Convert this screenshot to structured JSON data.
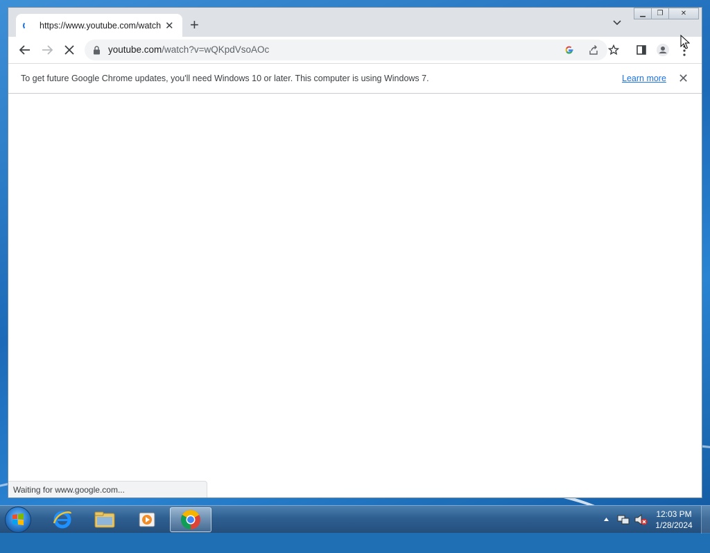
{
  "browser": {
    "tab_title": "https://www.youtube.com/watch",
    "url_host": "youtube.com",
    "url_path": "/watch?v=wQKpdVsoAOc",
    "status_text": "Waiting for www.google.com..."
  },
  "infobar": {
    "message": "To get future Google Chrome updates, you'll need Windows 10 or later. This computer is using Windows 7.",
    "learn_more": "Learn more"
  },
  "taskbar": {
    "time": "12:03 PM",
    "date": "1/28/2024",
    "items": [
      "internet-explorer",
      "windows-explorer",
      "media-player",
      "google-chrome"
    ]
  },
  "colors": {
    "accent": "#1a73e8",
    "toolbar_bg": "#ffffff",
    "tabstrip_bg": "#dee1e6"
  }
}
